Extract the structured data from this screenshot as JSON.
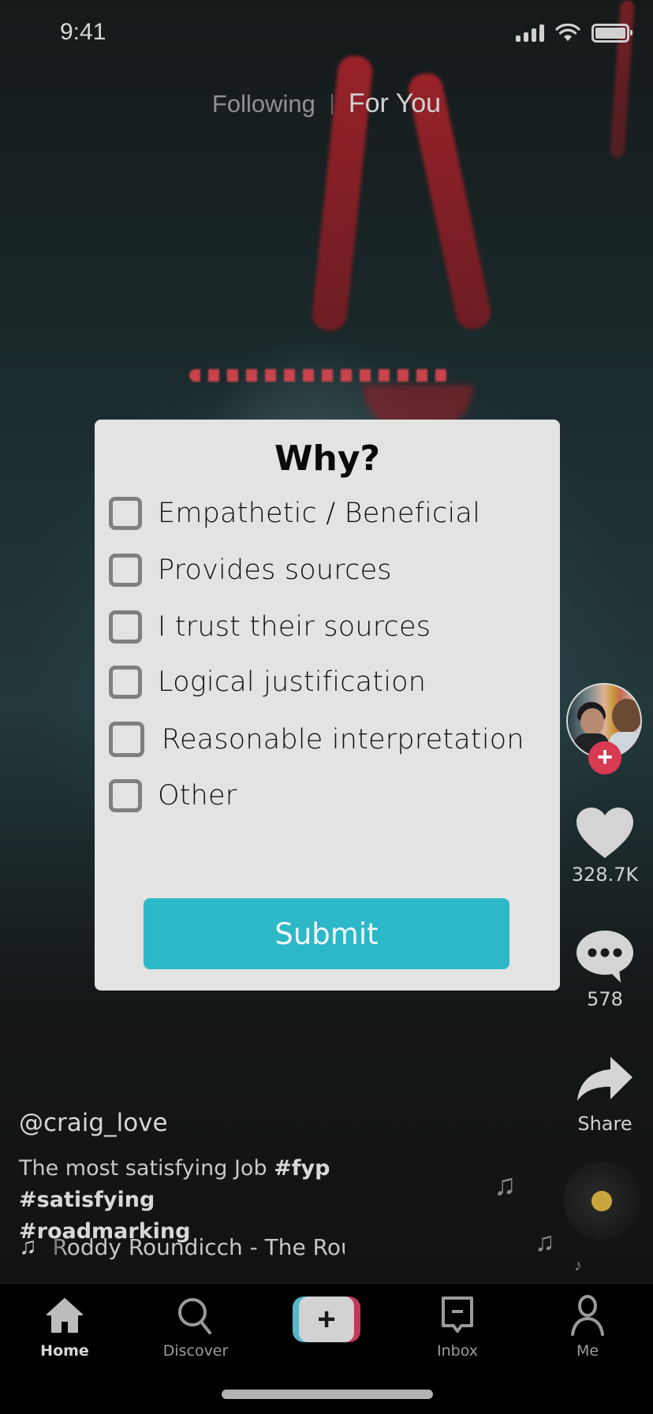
{
  "status_bar": {
    "time": "9:41",
    "icons": [
      "cellular-signal-icon",
      "wifi-icon",
      "battery-icon"
    ]
  },
  "top_tabs": {
    "following": "Following",
    "for_you": "For You",
    "active": "For You"
  },
  "modal": {
    "title": "Why?",
    "options": [
      {
        "label": "Empathetic / Beneficial",
        "checked": false
      },
      {
        "label": "Provides sources",
        "checked": false
      },
      {
        "label": "I trust their sources",
        "checked": false
      },
      {
        "label": "Logical justification",
        "checked": false
      },
      {
        "label": "Reasonable interpretation",
        "checked": false
      },
      {
        "label": "Other",
        "checked": false
      }
    ],
    "submit_label": "Submit",
    "submit_color": "#2db8c8"
  },
  "right_rail": {
    "follow_icon": "plus-icon",
    "like_count": "328.7K",
    "comment_count": "578",
    "share_label": "Share"
  },
  "video": {
    "username": "@craig_love",
    "caption_text": "The most satisfying Job",
    "hashtags": [
      "#fyp",
      "#satisfying",
      "#roadmarking"
    ],
    "music_title": "Roddy Roundicch - The Rou"
  },
  "bottom_nav": {
    "items": [
      {
        "label": "Home",
        "icon": "home-icon",
        "active": true
      },
      {
        "label": "Discover",
        "icon": "search-icon",
        "active": false
      },
      {
        "label": "",
        "icon": "create-plus-icon",
        "active": false
      },
      {
        "label": "Inbox",
        "icon": "inbox-icon",
        "active": false
      },
      {
        "label": "Me",
        "icon": "profile-icon",
        "active": false
      }
    ]
  },
  "colors": {
    "follow_badge": "#d83a52",
    "create_left": "#57b6c8",
    "create_right": "#c2395a",
    "music_disc_center": "#c9a63c"
  }
}
